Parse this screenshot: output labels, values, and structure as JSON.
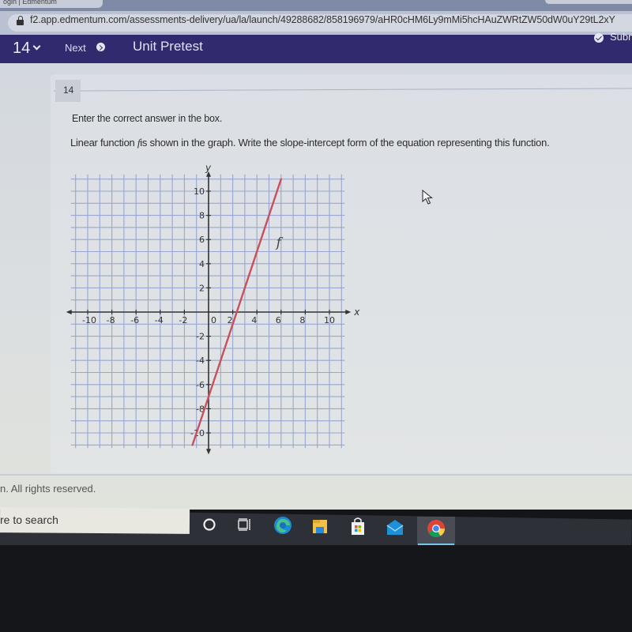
{
  "browser": {
    "tab_label": "ogin | Edmentum",
    "url": "f2.app.edmentum.com/assessments-delivery/ua/la/launch/49288682/858196979/aHR0cHM6Ly9mMi5hcHAuZWRtZW50dW0uY29tL2xY"
  },
  "header": {
    "question_number": "14",
    "next_label": "Next",
    "title": "Unit Pretest",
    "submit_label": "Submit",
    "brand_color": "#312a6e"
  },
  "question": {
    "badge": "14",
    "instruction": "Enter the correct answer in the box.",
    "prompt_before": "Linear function ",
    "prompt_var": "f",
    "prompt_after": "is shown in the graph. Write the slope-intercept form of the equation representing this function."
  },
  "chart_data": {
    "type": "line",
    "title": "",
    "xlabel": "x",
    "ylabel": "y",
    "xlim": [
      -11,
      11
    ],
    "ylim": [
      -11,
      11
    ],
    "grid": true,
    "grid_step": 1,
    "x_ticks": [
      -10,
      -8,
      -6,
      -4,
      -2,
      0,
      2,
      4,
      6,
      8,
      10
    ],
    "y_ticks": [
      -10,
      -8,
      -6,
      -4,
      -2,
      2,
      4,
      6,
      8,
      10
    ],
    "x_tick_labels": [
      "-10",
      "-8",
      "-6",
      "-4",
      "-2",
      "0",
      "2",
      "4",
      "6",
      "8",
      "10"
    ],
    "y_tick_labels": [
      "-10",
      "-8",
      "-6",
      "-4",
      "-2",
      "2",
      "4",
      "6",
      "8",
      "10"
    ],
    "series": [
      {
        "name": "f",
        "label": "f",
        "color": "#c8505e",
        "slope": 3,
        "intercept": -7,
        "x": [
          -1.33,
          6
        ],
        "y": [
          -11,
          11
        ]
      }
    ],
    "annotations": [
      {
        "text": "f",
        "x": 5.6,
        "y": 5.8
      }
    ]
  },
  "footer": {
    "copyright": "n. All rights reserved."
  },
  "taskbar": {
    "search_placeholder": "re to search",
    "apps": [
      "cortana",
      "task-view",
      "edge",
      "file-explorer",
      "microsoft-store",
      "mail",
      "chrome"
    ],
    "active_app": "chrome"
  }
}
